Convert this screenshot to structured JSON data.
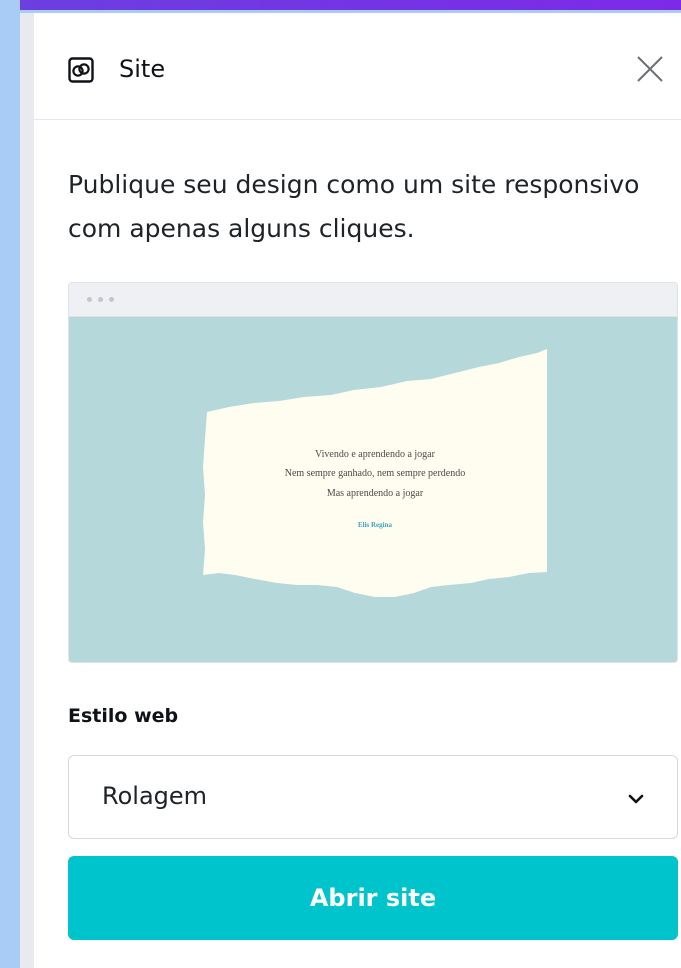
{
  "header": {
    "title": "Site",
    "icon": "website-icon",
    "close_icon": "close-icon"
  },
  "description": "Publique seu design como um site responsivo com apenas alguns cliques.",
  "preview": {
    "lines": [
      "Vivendo e aprendendo a jogar",
      "Nem sempre ganhado, nem sempre perdendo",
      "Mas aprendendo a jogar"
    ],
    "author": "Elis Regina",
    "colors": {
      "background": "#b5d8da",
      "paper": "#fffdf0",
      "author": "#3aa6b9"
    }
  },
  "web_style": {
    "label": "Estilo web",
    "selected": "Rolagem",
    "chevron_icon": "chevron-down-icon"
  },
  "actions": {
    "open_site_label": "Abrir site"
  },
  "colors": {
    "accent": "#00c4cc",
    "top_bar": "#7d2ae8"
  }
}
